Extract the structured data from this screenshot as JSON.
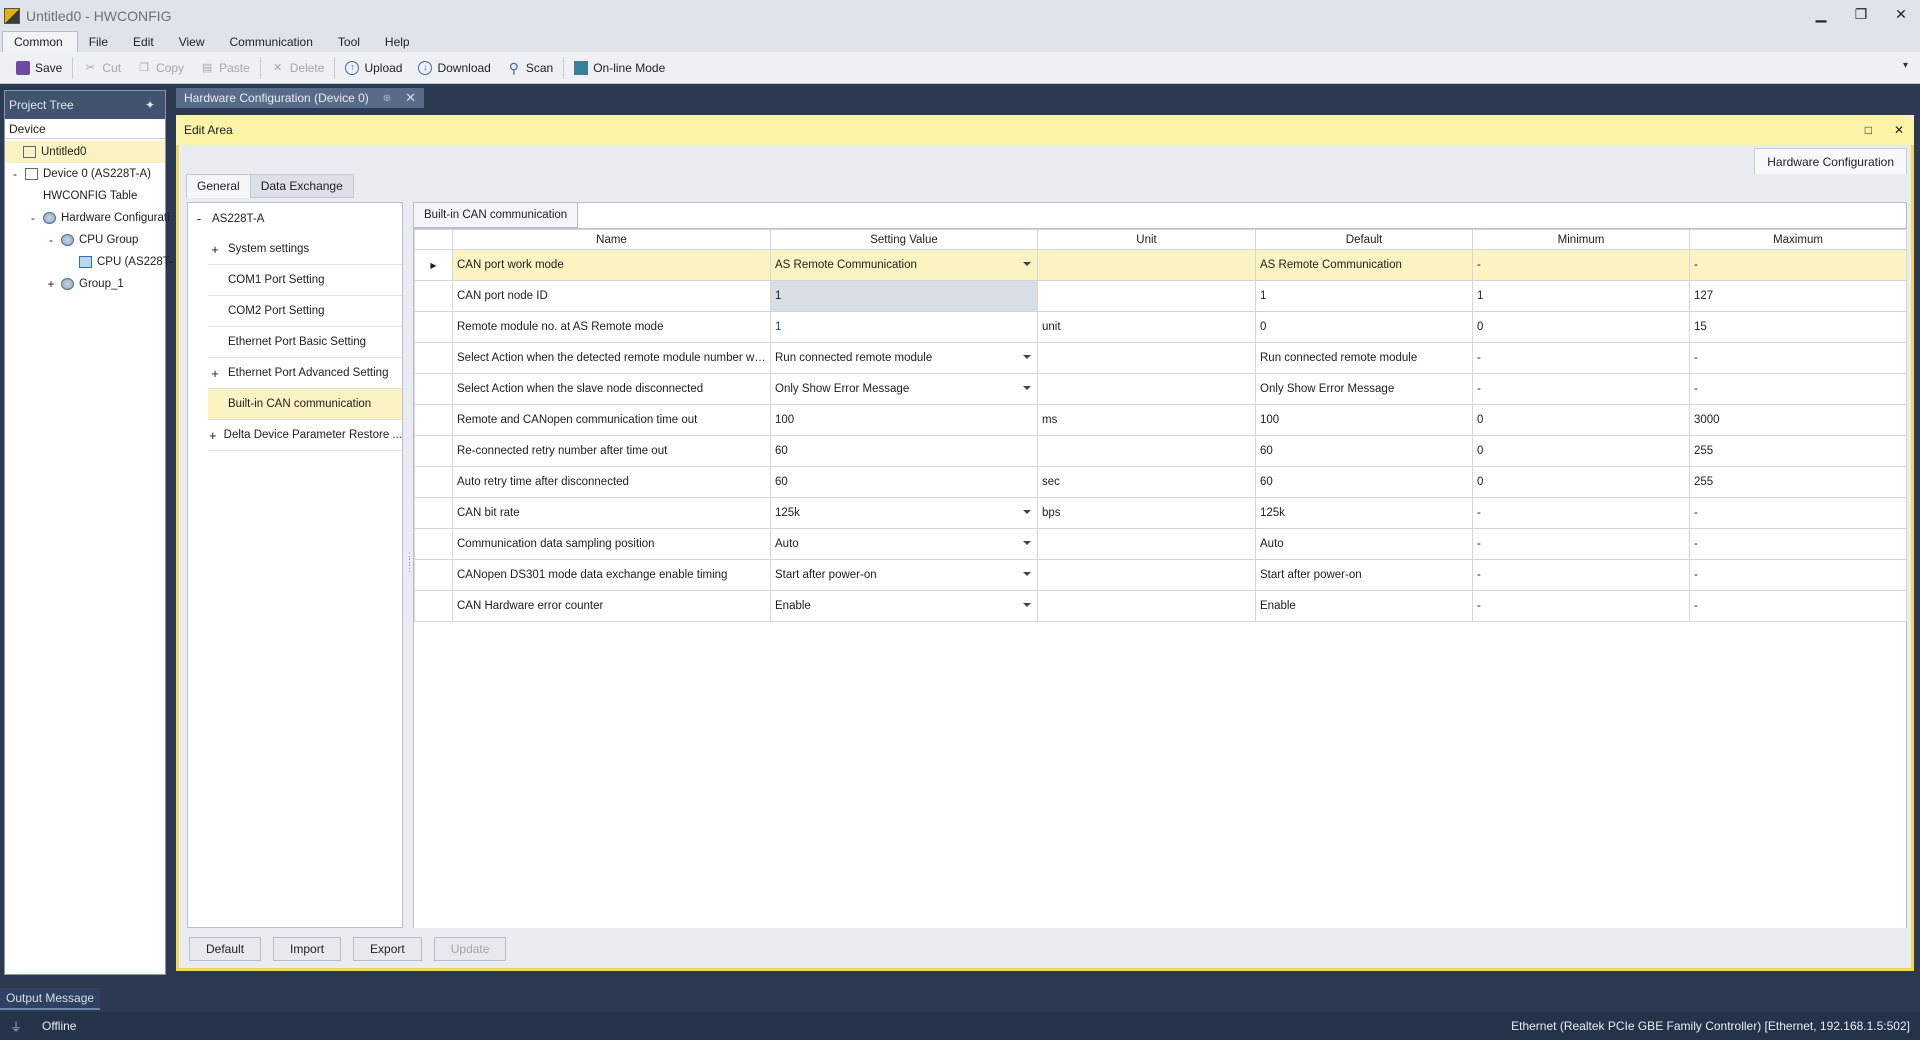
{
  "window": {
    "title": "Untitled0 - HWCONFIG",
    "controls": [
      "▁",
      "❐",
      "✕"
    ]
  },
  "menu": [
    "Common",
    "File",
    "Edit",
    "View",
    "Communication",
    "Tool",
    "Help"
  ],
  "toolbar": {
    "save": "Save",
    "cut": "Cut",
    "copy": "Copy",
    "paste": "Paste",
    "delete": "Delete",
    "upload": "Upload",
    "download": "Download",
    "scan": "Scan",
    "online": "On-line Mode",
    "overflow": "▾"
  },
  "project_tree": {
    "header": "Project Tree",
    "pin": "✦",
    "device_label": "Device",
    "items": [
      {
        "label": "Untitled0",
        "toggle": ""
      },
      {
        "label": "Device 0 (AS228T-A)",
        "toggle": "-"
      },
      {
        "label": "HWCONFIG Table",
        "toggle": ""
      },
      {
        "label": "Hardware Configurati",
        "toggle": "-"
      },
      {
        "label": "CPU Group",
        "toggle": "-"
      },
      {
        "label": "CPU (AS228T-",
        "toggle": ""
      },
      {
        "label": "Group_1",
        "toggle": "+"
      }
    ]
  },
  "doc_tab": {
    "label": "Hardware Configuration (Device 0)",
    "pin": "⊕",
    "close": "✕"
  },
  "edit_area": {
    "title": "Edit Area",
    "maximize": "□",
    "close": "✕",
    "right_tab": "Hardware Configuration",
    "tabs": [
      "General",
      "Data Exchange"
    ]
  },
  "settings_tree": {
    "root": {
      "label": "AS228T-A",
      "toggle": "-"
    },
    "items": [
      {
        "label": "System settings",
        "toggle": "+"
      },
      {
        "label": "COM1 Port Setting",
        "toggle": ""
      },
      {
        "label": "COM2 Port Setting",
        "toggle": ""
      },
      {
        "label": "Ethernet Port Basic Setting",
        "toggle": ""
      },
      {
        "label": "Ethernet Port Advanced Setting",
        "toggle": "+"
      },
      {
        "label": "Built-in CAN communication",
        "toggle": ""
      },
      {
        "label": "Delta Device Parameter Restore ...",
        "toggle": "+"
      }
    ]
  },
  "param_table": {
    "tab": "Built-in CAN communication",
    "columns": [
      "Name",
      "Setting Value",
      "Unit",
      "Default",
      "Minimum",
      "Maximum"
    ],
    "rows": [
      {
        "name": "CAN port work mode",
        "value": "AS Remote Communication",
        "unit": "",
        "default": "AS Remote Communication",
        "min": "-",
        "max": "-"
      },
      {
        "name": "CAN port node ID",
        "value": "1",
        "unit": "",
        "default": "1",
        "min": "1",
        "max": "127"
      },
      {
        "name": "Remote module no. at AS Remote mode",
        "value": "1",
        "unit": "unit",
        "default": "0",
        "min": "0",
        "max": "15"
      },
      {
        "name": "Select Action when the detected remote module number was w...",
        "value": "Run connected remote module",
        "unit": "",
        "default": "Run connected remote module",
        "min": "-",
        "max": "-"
      },
      {
        "name": "Select Action when the slave node disconnected",
        "value": "Only Show Error Message",
        "unit": "",
        "default": "Only Show Error Message",
        "min": "-",
        "max": "-"
      },
      {
        "name": "Remote and CANopen communication time out",
        "value": "100",
        "unit": "ms",
        "default": "100",
        "min": "0",
        "max": "3000"
      },
      {
        "name": "Re-connected retry number after time out",
        "value": "60",
        "unit": "",
        "default": "60",
        "min": "0",
        "max": "255"
      },
      {
        "name": "Auto retry time after disconnected",
        "value": "60",
        "unit": "sec",
        "default": "60",
        "min": "0",
        "max": "255"
      },
      {
        "name": "CAN bit rate",
        "value": "125k",
        "unit": "bps",
        "default": "125k",
        "min": "-",
        "max": "-"
      },
      {
        "name": "Communication data sampling position",
        "value": "Auto",
        "unit": "",
        "default": "Auto",
        "min": "-",
        "max": "-"
      },
      {
        "name": "CANopen DS301 mode data exchange enable timing",
        "value": "Start after power-on",
        "unit": "",
        "default": "Start after power-on",
        "min": "-",
        "max": "-"
      },
      {
        "name": "CAN Hardware error counter",
        "value": "Enable",
        "unit": "",
        "default": "Enable",
        "min": "-",
        "max": "-"
      }
    ]
  },
  "bottom_buttons": {
    "default": "Default",
    "import": "Import",
    "export": "Export",
    "update": "Update"
  },
  "output": {
    "tab": "Output Message"
  },
  "status": {
    "state": "Offline",
    "connection": "Ethernet (Realtek PCIe GBE Family Controller) [Ethernet, 192.168.1.5:502]"
  },
  "colors": {
    "accent_yellow": "#fbf4a7",
    "selection": "#fcf3c2",
    "dark_frame": "#2b3a52",
    "panel_header": "#42536f"
  }
}
